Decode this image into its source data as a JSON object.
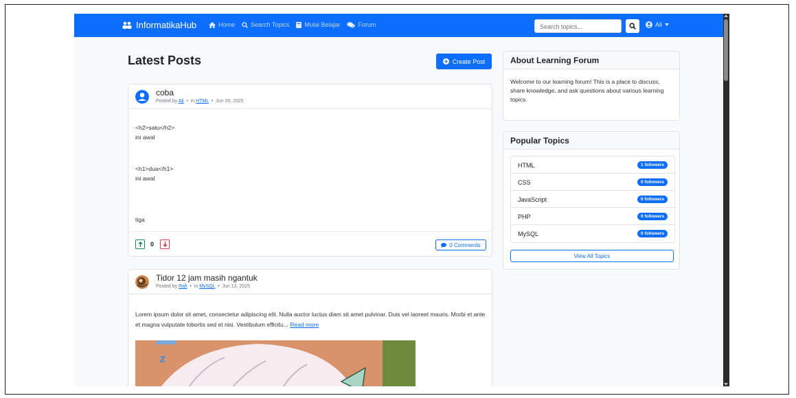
{
  "navbar": {
    "brand": "InformatikaHub",
    "links": [
      "Home",
      "Search Topics",
      "Mulai Belajar",
      "Forum"
    ],
    "search_placeholder": "Search topics...",
    "user": "Ali"
  },
  "main": {
    "title": "Latest Posts",
    "create_button": "Create Post"
  },
  "posts": [
    {
      "title": "coba",
      "posted_by_prefix": "Posted by",
      "author": "Ali",
      "in_word": "in",
      "topic": "HTML",
      "date": "Jun 20, 2025",
      "body": [
        "<h2>satu</h2>",
        "ini awal",
        "<h1>dua</h1>",
        "ini awal",
        "tiga"
      ],
      "votes": "0",
      "comments": "0 Comments"
    },
    {
      "title": "Tidor 12 jam masih ngantuk",
      "posted_by_prefix": "Posted by",
      "author": "Rafi",
      "in_word": "in",
      "topic": "MySQL",
      "date": "Jun 13, 2025",
      "excerpt": "Lorem ipsum dolor sit amet, consectetur adipiscing elit. Nulla auctor luctus diam sit amet pulvinar. Duis vel laoreet mauris. Morbi et ante et magna vulputate lobortis sed et nisi. Vestibulum efficitu...",
      "read_more": "Read more"
    }
  ],
  "sidebar": {
    "about_title": "About Learning Forum",
    "about_text": "Welcome to our learning forum! This is a place to discuss, share knowledge, and ask questions about various learning topics.",
    "popular_title": "Popular Topics",
    "topics": [
      {
        "name": "HTML",
        "followers": "1 followers"
      },
      {
        "name": "CSS",
        "followers": "0 followers"
      },
      {
        "name": "JavaScript",
        "followers": "0 followers"
      },
      {
        "name": "PHP",
        "followers": "0 followers"
      },
      {
        "name": "MySQL",
        "followers": "0 followers"
      }
    ],
    "view_all": "View All Topics"
  },
  "colors": {
    "primary": "#0d6efd",
    "success": "#198754",
    "danger": "#dc3545"
  }
}
